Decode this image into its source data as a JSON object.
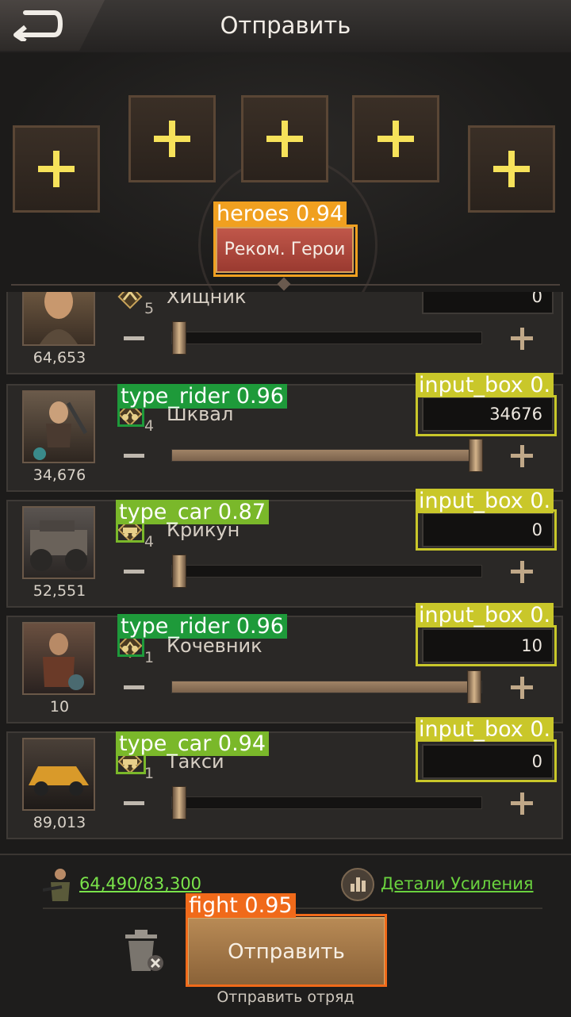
{
  "header": {
    "title": "Отправить"
  },
  "hero_slots": [
    {
      "id": "slot1"
    },
    {
      "id": "slot2"
    },
    {
      "id": "slot3"
    },
    {
      "id": "slot4"
    },
    {
      "id": "slot5"
    }
  ],
  "recommended_heroes_label": "Реком. Герои",
  "troops": [
    {
      "name": "Хищник",
      "tier": "5",
      "power": "64,653",
      "count": "0",
      "fill": 0.0
    },
    {
      "name": "Шквал",
      "tier": "4",
      "power": "34,676",
      "count": "34676",
      "fill": 1.0
    },
    {
      "name": "Крикун",
      "tier": "4",
      "power": "52,551",
      "count": "0",
      "fill": 0.0
    },
    {
      "name": "Кочевник",
      "tier": "1",
      "power": "10",
      "count": "10",
      "fill": 1.0
    },
    {
      "name": "Такси",
      "tier": "1",
      "power": "89,013",
      "count": "0",
      "fill": 0.0
    }
  ],
  "detections": {
    "heroes": "heroes 0.94",
    "rider1": "type_rider 0.96",
    "input1": "input_box 0.",
    "car1": "type_car 0.87",
    "input2": "input_box 0.",
    "rider2": "type_rider 0.96",
    "input3": "input_box 0.",
    "car2": "type_car 0.94",
    "input4": "input_box 0.",
    "fight": "fight 0.95"
  },
  "bottom": {
    "capacity": "64,490/83,300",
    "boost_details": "Детали Усиления",
    "send_label": "Отправить",
    "send_hint": "Отправить отряд"
  },
  "colors": {
    "accent": "#d8a25a",
    "green_link": "#7ae34a",
    "det_orange": "#f0a020",
    "det_green": "#1e9a3a",
    "det_lime": "#7ab82a",
    "det_yellow": "#c9c72a",
    "det_fight": "#f06a1a"
  }
}
